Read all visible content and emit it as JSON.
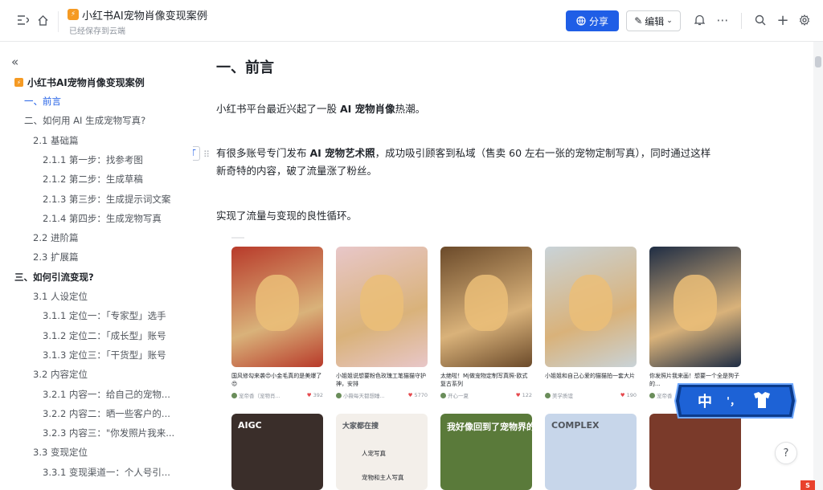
{
  "header": {
    "doc_title": "小红书AI宠物肖像变现案例",
    "saved_status": "已经保存到云端",
    "share_label": "分享",
    "edit_label": "编辑"
  },
  "toc": {
    "root": "小红书AI宠物肖像变现案例",
    "items": [
      {
        "label": "一、前言",
        "level": 1,
        "active": true
      },
      {
        "label": "二、如何用 AI 生成宠物写真?",
        "level": 1
      },
      {
        "label": "2.1 基础篇",
        "level": 2
      },
      {
        "label": "2.1.1 第一步：找参考图",
        "level": 3
      },
      {
        "label": "2.1.2 第二步：生成草稿",
        "level": 3
      },
      {
        "label": "2.1.3 第三步：生成提示词文案",
        "level": 3
      },
      {
        "label": "2.1.4 第四步：生成宠物写真",
        "level": 3
      },
      {
        "label": "2.2 进阶篇",
        "level": 2
      },
      {
        "label": "2.3 扩展篇",
        "level": 2
      },
      {
        "label": "三、如何引流变现?",
        "level": 1,
        "bold": true
      },
      {
        "label": "3.1 人设定位",
        "level": 2
      },
      {
        "label": "3.1.1 定位一：「专家型」选手",
        "level": 3
      },
      {
        "label": "3.1.2 定位二：「成长型」账号",
        "level": 3
      },
      {
        "label": "3.1.3 定位三：「干货型」账号",
        "level": 3
      },
      {
        "label": "3.2 内容定位",
        "level": 2
      },
      {
        "label": "3.2.1 内容一：给自己的宠物...",
        "level": 3
      },
      {
        "label": "3.2.2 内容二：晒一些客户的...",
        "level": 3
      },
      {
        "label": "3.2.3 内容三：\"你发照片我来...",
        "level": 3
      },
      {
        "label": "3.3 变现定位",
        "level": 2
      },
      {
        "label": "3.3.1 变现渠道一：个人号引...",
        "level": 3
      }
    ]
  },
  "doc": {
    "heading": "一、前言",
    "p1_pre": "小红书平台最近兴起了一股 ",
    "p1_bold": "AI 宠物肖像",
    "p1_post": "热潮。",
    "p2_pre": "有很多账号专门发布 ",
    "p2_bold": "AI 宠物艺术照",
    "p2_line1_post": "，成功吸引顾客到私域（售卖 60 左右一张的宠物定制写真），同时通过这样",
    "p2_line2": "新奇特的内容，破了流量涨了粉丝。",
    "p3": "实现了流量与变现的良性循环。"
  },
  "cards_row1": [
    {
      "caption": "国风修勾来袭😍小金毛真的是美爆了😍",
      "user": "宠帝香（宠物肖...",
      "likes": "392",
      "color": "#b83a2a"
    },
    {
      "caption": "小姐姐说想要粉色玫瑰工笔猫猫守护神，安排",
      "user": "小薇每天都想睡...",
      "likes": "5770",
      "color": "#e8c7c9"
    },
    {
      "caption": "太绝啦！Mj做宠物定制写真照-欧式复古系列",
      "user": "开心一夏",
      "likes": "122",
      "color": "#6b4a2a"
    },
    {
      "caption": "小姐姐和自己心爱的猫猫拍一套大片",
      "user": "美学质谊",
      "likes": "190",
      "color": "#c9d3d8"
    },
    {
      "caption": "你发照片我来画！想要一个全是狗子的...",
      "user": "宠帝香",
      "likes": "",
      "color": "#1f2d44"
    }
  ],
  "cards_row2": [
    {
      "overlay": "AIGC",
      "color": "#3a2e2a"
    },
    {
      "overlay": "大家都在搜",
      "color": "#f3efea",
      "items": [
        "人宠写真",
        "宠物和主人写真"
      ]
    },
    {
      "overlay": "我好像回到了宠物界的风口...",
      "color": "#5a7a3a"
    },
    {
      "overlay": "COMPLEX",
      "color": "#c7d6ea"
    },
    {
      "overlay": "",
      "color": "#7a3a2a"
    }
  ],
  "ime": {
    "label": "中",
    "punct": "'，",
    "shirt": "👕"
  },
  "help_label": "?",
  "corner_label": "S"
}
